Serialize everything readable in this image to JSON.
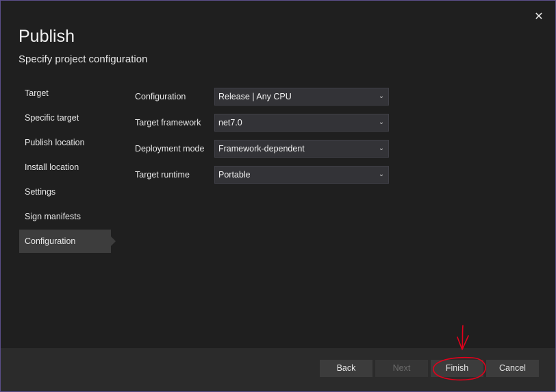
{
  "dialog": {
    "title": "Publish",
    "subtitle": "Specify project configuration",
    "close_glyph": "✕"
  },
  "nav": {
    "items": [
      {
        "label": "Target"
      },
      {
        "label": "Specific target"
      },
      {
        "label": "Publish location"
      },
      {
        "label": "Install location"
      },
      {
        "label": "Settings"
      },
      {
        "label": "Sign manifests"
      },
      {
        "label": "Configuration",
        "active": true
      }
    ]
  },
  "form": {
    "configuration": {
      "label": "Configuration",
      "value": "Release | Any CPU"
    },
    "target_framework": {
      "label": "Target framework",
      "value": "net7.0"
    },
    "deployment_mode": {
      "label": "Deployment mode",
      "value": "Framework-dependent"
    },
    "target_runtime": {
      "label": "Target runtime",
      "value": "Portable"
    }
  },
  "footer": {
    "back_label": "Back",
    "next_label": "Next",
    "finish_label": "Finish",
    "cancel_label": "Cancel"
  },
  "colors": {
    "accent_border": "#5d4f8c",
    "annotation_red": "#e3001b"
  },
  "icons": {
    "close": "close-icon",
    "dropdown": "chevron-down-icon"
  }
}
